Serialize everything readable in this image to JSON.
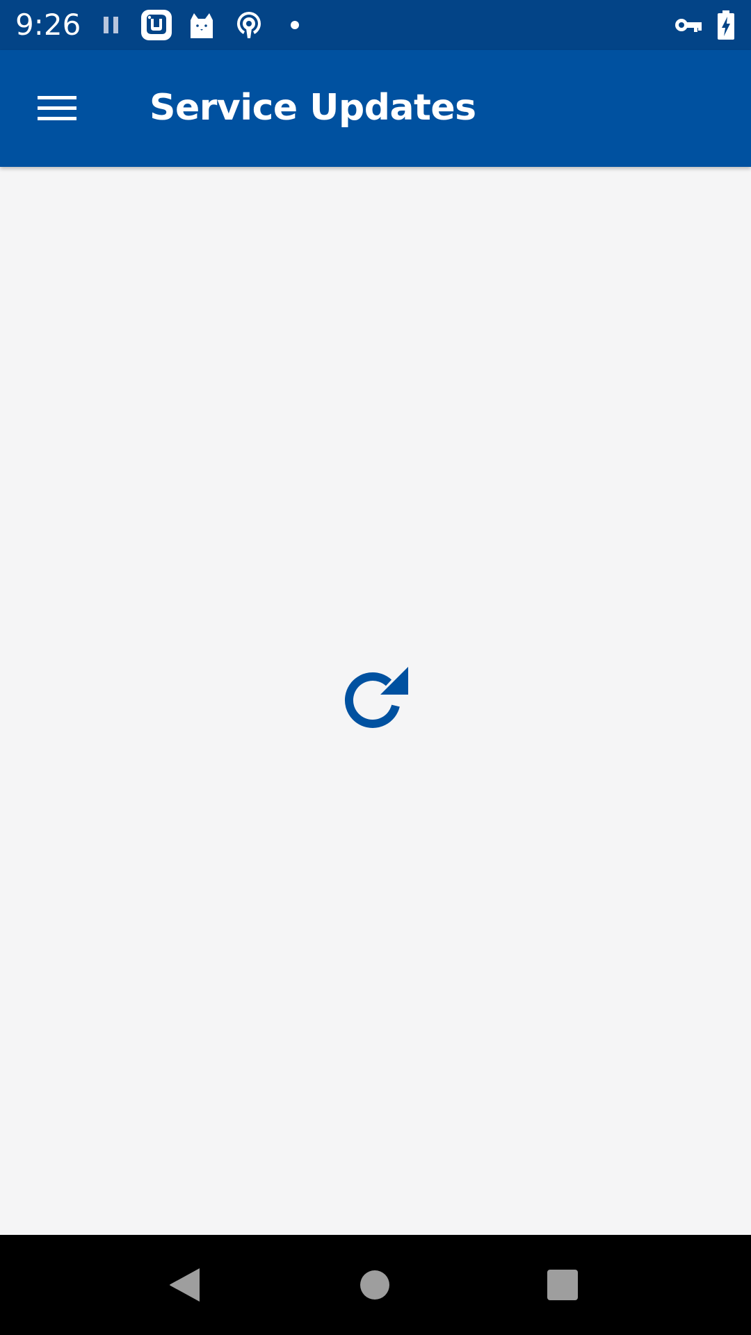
{
  "status_bar": {
    "time": "9:26",
    "background_color": "#034487",
    "icons": [
      "pause-icon",
      "app-notification-icon",
      "cat-notification-icon",
      "podcast-notification-icon",
      "dot-icon",
      "vpn-key-icon",
      "battery-charging-icon"
    ]
  },
  "app_bar": {
    "title": "Service Updates",
    "menu_icon": "hamburger-menu-icon",
    "background_color": "#0051a0"
  },
  "content": {
    "state": "loading",
    "refresh_icon": "refresh-icon",
    "accent_color": "#0051a0",
    "background_color": "#f5f5f6"
  },
  "nav_bar": {
    "buttons": [
      "back-icon",
      "home-icon",
      "recents-icon"
    ],
    "icon_color": "#9e9e9e"
  }
}
